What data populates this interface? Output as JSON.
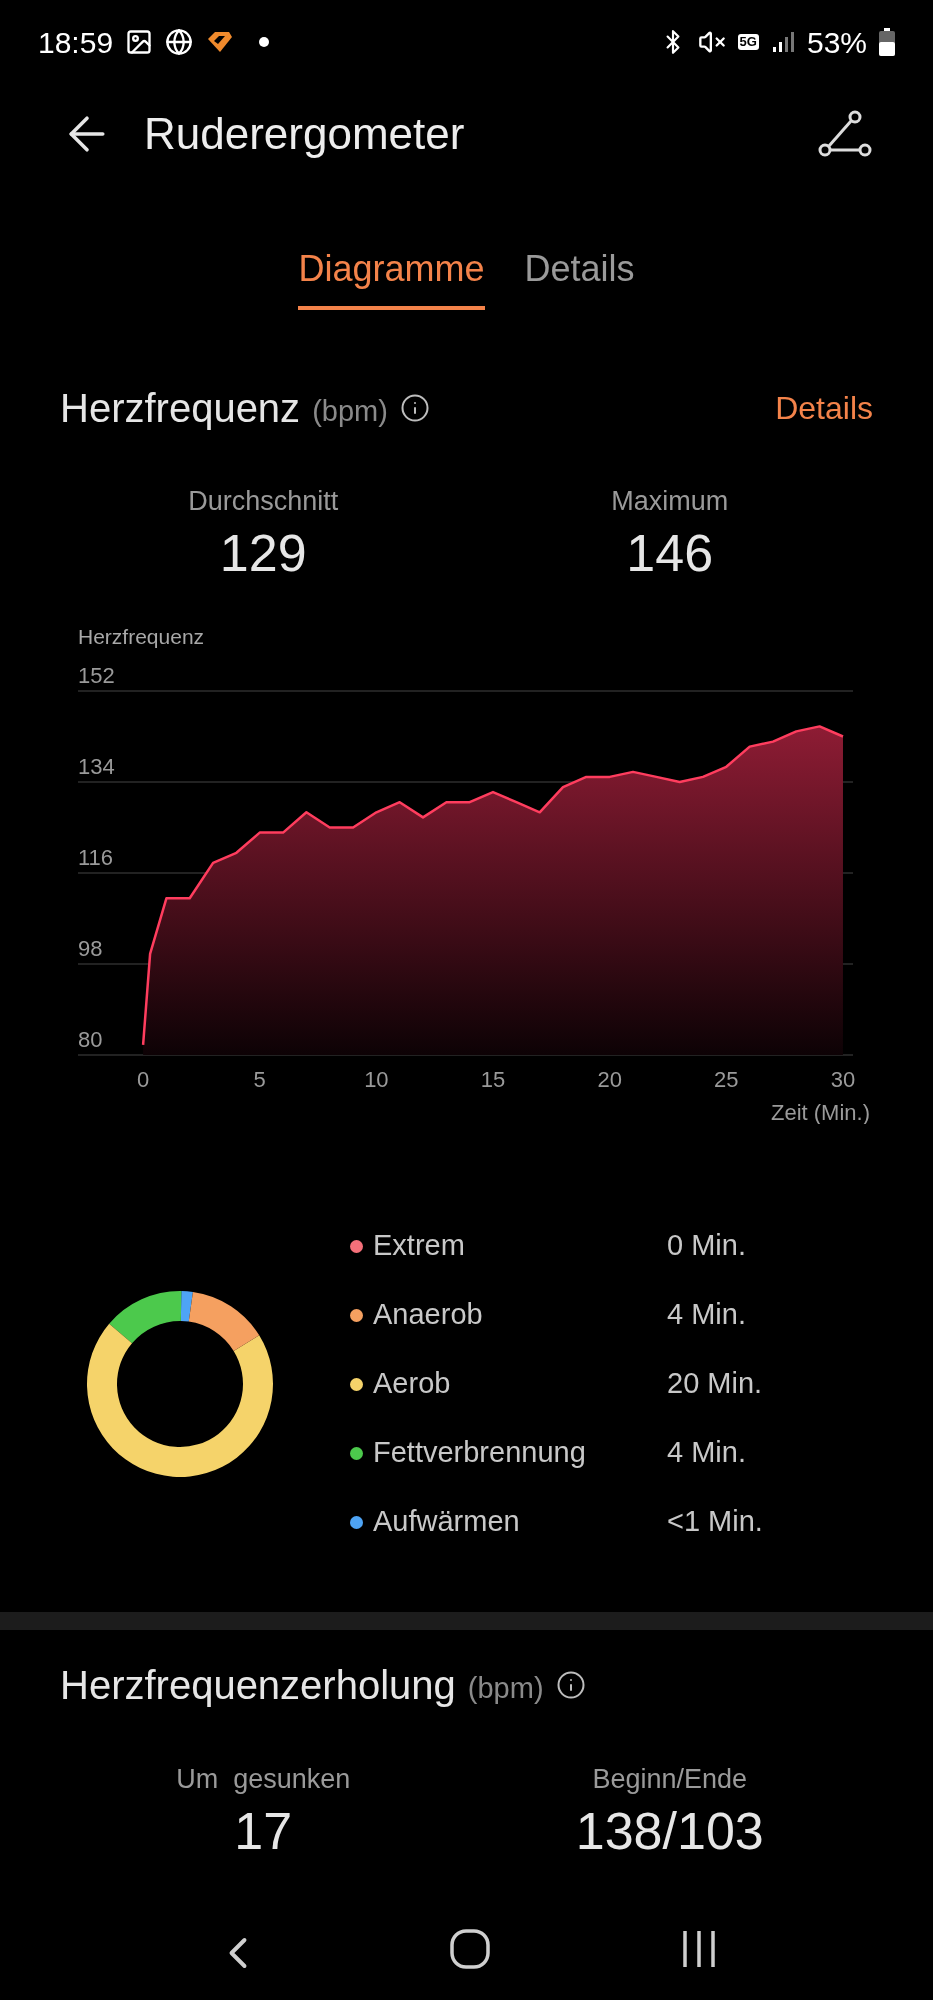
{
  "status_bar": {
    "time": "18:59",
    "network": "5G",
    "battery": "53%"
  },
  "header": {
    "title": "Ruderergometer"
  },
  "tabs": [
    {
      "label": "Diagramme",
      "selected": true
    },
    {
      "label": "Details",
      "selected": false
    }
  ],
  "heart_rate": {
    "title": "Herzfrequenz",
    "unit": "(bpm)",
    "link": "Details",
    "stats": [
      {
        "label": "Durchschnitt",
        "value": "129"
      },
      {
        "label": "Maximum",
        "value": "146"
      }
    ],
    "chart_data": {
      "type": "area",
      "xlabel": "Zeit (Min.)",
      "grid": true,
      "x": [
        0,
        0.3,
        1,
        2,
        3,
        4,
        5,
        6,
        7,
        8,
        9,
        10,
        11,
        12,
        13,
        14,
        15,
        16,
        17,
        18,
        19,
        20,
        21,
        22,
        23,
        24,
        25,
        26,
        27,
        28,
        29,
        30
      ],
      "series": [
        {
          "name": "Herzfrequenz",
          "color": "#ff3d5e",
          "values": [
            82,
            100,
            111,
            111,
            118,
            120,
            124,
            124,
            128,
            125,
            125,
            128,
            130,
            127,
            130,
            130,
            132,
            130,
            128,
            133,
            135,
            135,
            136,
            135,
            134,
            135,
            137,
            141,
            142,
            144,
            145,
            143
          ]
        }
      ],
      "xlim": [
        -2.79,
        30.43
      ],
      "ylim": [
        80,
        152
      ],
      "xticks": [
        0,
        5,
        10,
        15,
        20,
        25,
        30
      ],
      "yticks": [
        80,
        98,
        116,
        134,
        152
      ]
    }
  },
  "zones": {
    "chart_data": {
      "type": "donut",
      "categories": [
        "Extrem",
        "Anaerob",
        "Aerob",
        "Fettverbrennung",
        "Aufwärmen"
      ],
      "values": [
        0,
        14,
        70,
        14,
        2
      ]
    },
    "items": [
      {
        "duration": "0 Min.",
        "color": "#f5707a"
      },
      {
        "duration": "4 Min.",
        "color": "#f5a060"
      },
      {
        "duration": "20 Min.",
        "color": "#f5d36a"
      },
      {
        "duration": "4 Min.",
        "color": "#4cc94c"
      },
      {
        "duration": "<1 Min.",
        "color": "#4ea4f5"
      }
    ]
  },
  "recovery": {
    "title": "Herzfrequenzerholung",
    "unit": "(bpm)",
    "stats": [
      {
        "label": "Um  gesunken",
        "value": "17"
      },
      {
        "label": "Beginn/Ende",
        "value": "138/103"
      }
    ]
  }
}
